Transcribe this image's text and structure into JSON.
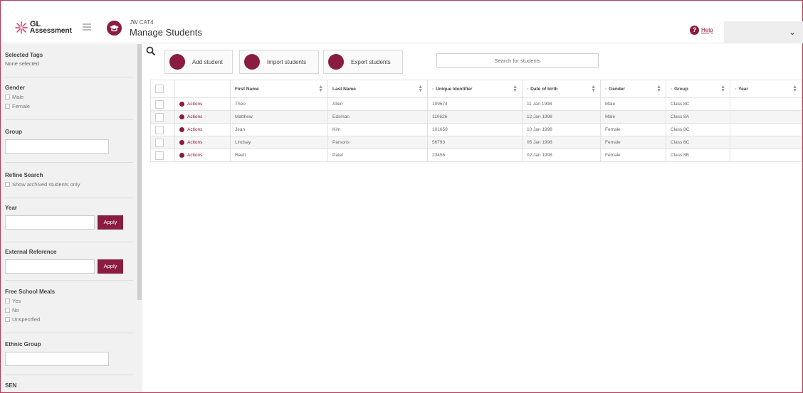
{
  "header": {
    "logo": {
      "line1": "GL",
      "line2": "Assessment"
    },
    "app_subtitle": "JW CAT4",
    "app_title": "Manage Students",
    "help_label": "Help"
  },
  "sidebar": {
    "selected_tags": {
      "title": "Selected Tags",
      "value": "None selected"
    },
    "gender": {
      "title": "Gender",
      "options": [
        "Male",
        "Female"
      ]
    },
    "group": {
      "title": "Group"
    },
    "refine": {
      "title": "Refine Search",
      "option": "Show archived students only"
    },
    "year": {
      "title": "Year",
      "apply": "Apply"
    },
    "external": {
      "title": "External Reference",
      "apply": "Apply"
    },
    "fsm": {
      "title": "Free School Meals",
      "options": [
        "Yes",
        "No",
        "Unspecified"
      ]
    },
    "ethnic": {
      "title": "Ethnic Group"
    },
    "sen": {
      "title": "SEN"
    }
  },
  "toolbar": {
    "add": "Add student",
    "import": "Import students",
    "export": "Export students",
    "search_placeholder": "Search for students"
  },
  "table": {
    "headers": [
      "First Name",
      "Last Name",
      "Unique Identifier",
      "Date of birth",
      "Gender",
      "Group",
      "Year"
    ],
    "actions_label": "Actions",
    "rows": [
      [
        "Theo",
        "Allen",
        "109674",
        "11 Jan 1998",
        "Male",
        "Class 8C",
        ""
      ],
      [
        "Matthew",
        "Edsman",
        "110626",
        "12 Jan 1998",
        "Male",
        "Class 8A",
        ""
      ],
      [
        "Jean",
        "Kim",
        "101659",
        "10 Jan 1998",
        "Female",
        "Class 8C",
        ""
      ],
      [
        "Lindsay",
        "Parsons",
        "56793",
        "05 Jan 1998",
        "Female",
        "Class 8C",
        ""
      ],
      [
        "Reeti",
        "Patel",
        "23456",
        "02 Jan 1998",
        "Female",
        "Class 8B",
        ""
      ]
    ]
  },
  "colors": {
    "brand": "#8a1b41"
  }
}
